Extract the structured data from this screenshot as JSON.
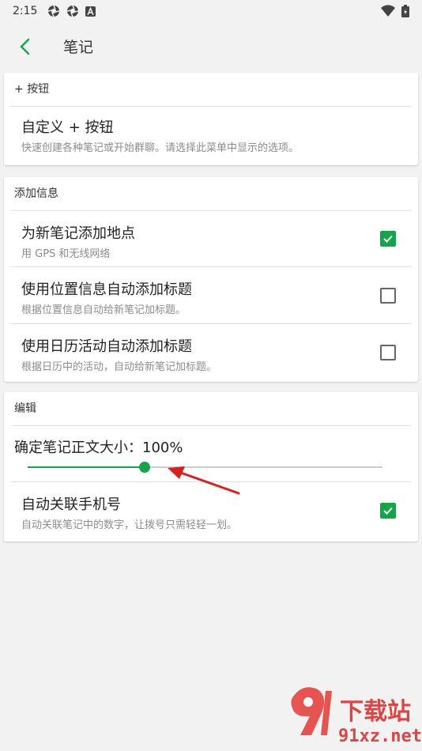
{
  "status": {
    "time": "2:15",
    "icons": [
      "aperture-icon",
      "aperture-icon",
      "a-notification-icon",
      "wifi-icon",
      "battery-icon"
    ]
  },
  "appbar": {
    "title": "笔记",
    "back_icon": "chevron-left-icon"
  },
  "sections": {
    "plus_button": {
      "header": "+ 按钮",
      "item": {
        "title": "自定义 + 按钮",
        "subtitle": "快速创建各种笔记或开始群聊。请选择此菜单中显示的选项。"
      }
    },
    "add_info": {
      "header": "添加信息",
      "items": [
        {
          "title": "为新笔记添加地点",
          "subtitle": "用 GPS 和无线网络",
          "checked": true
        },
        {
          "title": "使用位置信息自动添加标题",
          "subtitle": "根据位置信息自动给新笔记加标题。",
          "checked": false
        },
        {
          "title": "使用日历活动自动添加标题",
          "subtitle": "根据日历中的活动，自动给新笔记加标题。",
          "checked": false
        }
      ]
    },
    "edit": {
      "header": "编辑",
      "font_size": {
        "label": "确定笔记正文大小：100%",
        "slider_value": 0.33
      },
      "auto_link": {
        "title": "自动关联手机号",
        "subtitle": "自动关联笔记中的数字，让拨号只需轻轻一划。",
        "checked": true
      }
    }
  },
  "colors": {
    "accent": "#17a34a",
    "annotation_arrow": "#d92020"
  },
  "watermark": {
    "site_cn": "下载站",
    "domain": "91xz.net"
  }
}
